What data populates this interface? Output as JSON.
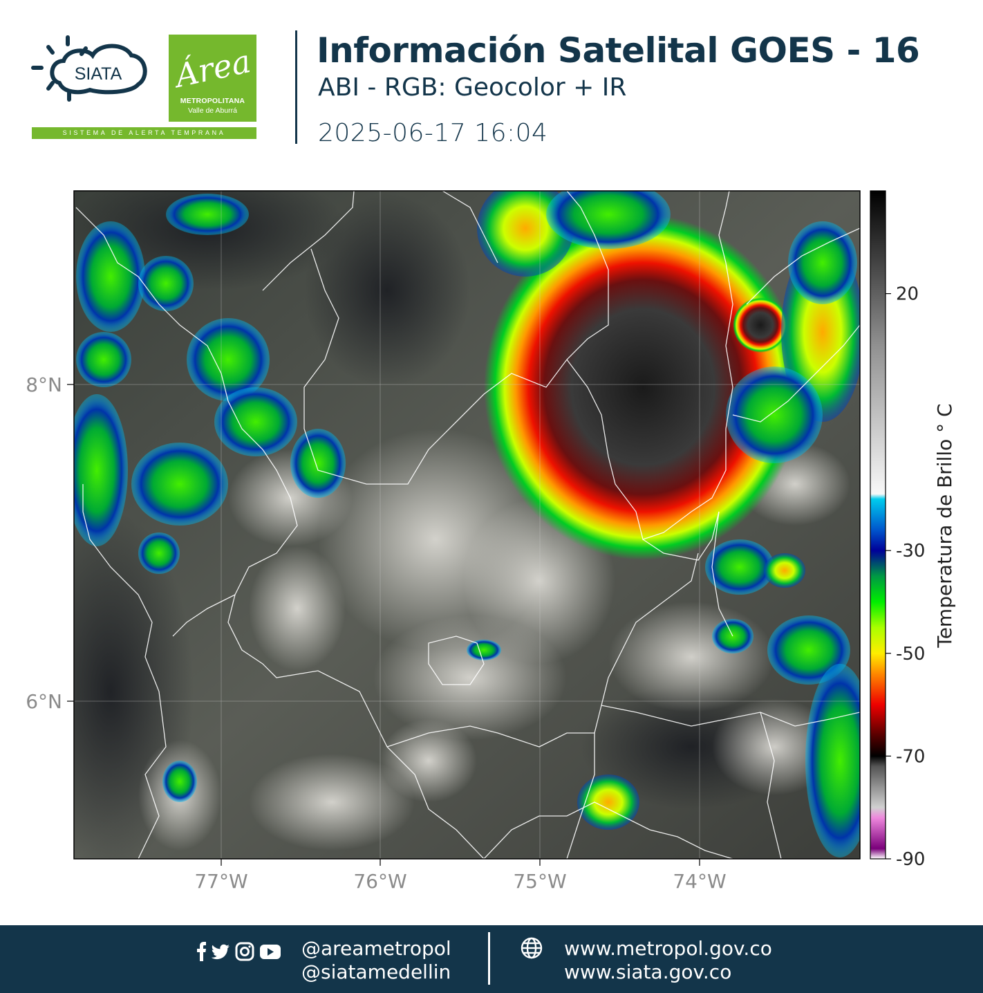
{
  "header": {
    "logo_siata_text": "SIATA",
    "logo_area_word": "Área",
    "logo_area_line1": "METROPOLITANA",
    "logo_area_line2": "Valle de Aburrá",
    "tagline": "SISTEMA DE ALERTA TEMPRANA",
    "title": "Información Satelital GOES - 16",
    "subtitle": "ABI - RGB: Geocolor + IR",
    "datetime": "2025-06-17 16:04"
  },
  "map": {
    "lat_ticks": [
      {
        "value": 8,
        "label": "8°N"
      },
      {
        "value": 6,
        "label": "6°N"
      }
    ],
    "lon_ticks": [
      {
        "value": -77,
        "label": "77°W"
      },
      {
        "value": -76,
        "label": "76°W"
      },
      {
        "value": -75,
        "label": "75°W"
      },
      {
        "value": -74,
        "label": "74°W"
      }
    ]
  },
  "colorbar": {
    "title": "Temperatura de Brillo ° C",
    "ticks": [
      {
        "value": 20,
        "label": "20"
      },
      {
        "value": -30,
        "label": "-30"
      },
      {
        "value": -50,
        "label": "-50"
      },
      {
        "value": -70,
        "label": "-70"
      },
      {
        "value": -90,
        "label": "-90"
      }
    ],
    "range": [
      -90,
      40
    ],
    "stops": [
      {
        "t": -92,
        "color": "#ffffff"
      },
      {
        "t": -88,
        "color": "#7a007a"
      },
      {
        "t": -82,
        "color": "#ee88dd"
      },
      {
        "t": -80,
        "color": "#d0d0d0"
      },
      {
        "t": -72,
        "color": "#555555"
      },
      {
        "t": -70,
        "color": "#000000"
      },
      {
        "t": -66,
        "color": "#550000"
      },
      {
        "t": -60,
        "color": "#ee0000"
      },
      {
        "t": -54,
        "color": "#ff8800"
      },
      {
        "t": -50,
        "color": "#ffee00"
      },
      {
        "t": -45,
        "color": "#aaff00"
      },
      {
        "t": -40,
        "color": "#00ee00"
      },
      {
        "t": -35,
        "color": "#009944"
      },
      {
        "t": -30,
        "color": "#000099"
      },
      {
        "t": -26,
        "color": "#0055cc"
      },
      {
        "t": -20,
        "color": "#00ccee"
      },
      {
        "t": -19,
        "color": "#f8f8f8"
      },
      {
        "t": 10,
        "color": "#909090"
      },
      {
        "t": 40,
        "color": "#000000"
      }
    ]
  },
  "footer": {
    "social_handle_1": "@areametropol",
    "social_handle_2": "@siatamedellin",
    "website_1": "www.metropol.gov.co",
    "website_2": "www.siata.gov.co",
    "icons": [
      "facebook-icon",
      "twitter-icon",
      "instagram-icon",
      "youtube-icon",
      "globe-icon"
    ]
  }
}
